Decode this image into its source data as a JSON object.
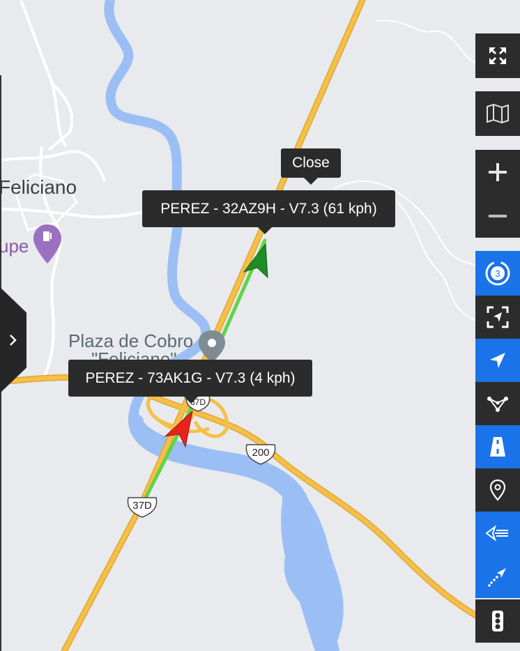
{
  "map": {
    "place_labels": {
      "town": "Feliciano",
      "poi_line1": "Plaza de Cobro",
      "poi_line2": "\"Feliciano\"",
      "lupe": "upe"
    },
    "road_shields": {
      "route_200": "200",
      "route_37d": "37D",
      "route_37d_top": "37D"
    },
    "colors": {
      "background": "#e8eaed",
      "water": "#9bbff5",
      "highway": "#f5c04a",
      "highway_casing": "#e0a62e",
      "minor_road": "#ffffff",
      "track_green": "#5fd44a",
      "vehicle_green": "#1f8c2a",
      "vehicle_red": "#e8231c",
      "gas_pin": "#9b70c0"
    }
  },
  "popups": {
    "close_label": "Close",
    "vehicle_a": "PEREZ - 32AZ9H - V7.3 (61 kph)",
    "vehicle_b": "PEREZ - 73AK1G - V7.3 (4 kph)"
  },
  "controls": {
    "items": [
      {
        "name": "fullscreen",
        "icon": "expand-arrows-icon",
        "style": "dark"
      },
      {
        "name": "map-type",
        "icon": "folded-map-icon",
        "style": "dark"
      },
      {
        "name": "zoom-in",
        "icon": "plus-icon",
        "style": "dark"
      },
      {
        "name": "zoom-out",
        "icon": "minus-icon",
        "style": "dark"
      },
      {
        "name": "clusters",
        "icon": "cluster-count-icon",
        "style": "blue",
        "badge": "3"
      },
      {
        "name": "fit-view",
        "icon": "focus-frame-icon",
        "style": "dark"
      },
      {
        "name": "follow-vehicle",
        "icon": "navigation-arrow-icon",
        "style": "blue"
      },
      {
        "name": "geofences",
        "icon": "polygon-icon",
        "style": "dark"
      },
      {
        "name": "roads",
        "icon": "road-icon",
        "style": "blue"
      },
      {
        "name": "pois",
        "icon": "location-pin-icon",
        "style": "dark"
      },
      {
        "name": "tracks",
        "icon": "trail-arrow-icon",
        "style": "blue"
      },
      {
        "name": "route-history",
        "icon": "dotted-route-icon",
        "style": "blue"
      },
      {
        "name": "traffic",
        "icon": "traffic-light-icon",
        "style": "dark"
      }
    ]
  }
}
